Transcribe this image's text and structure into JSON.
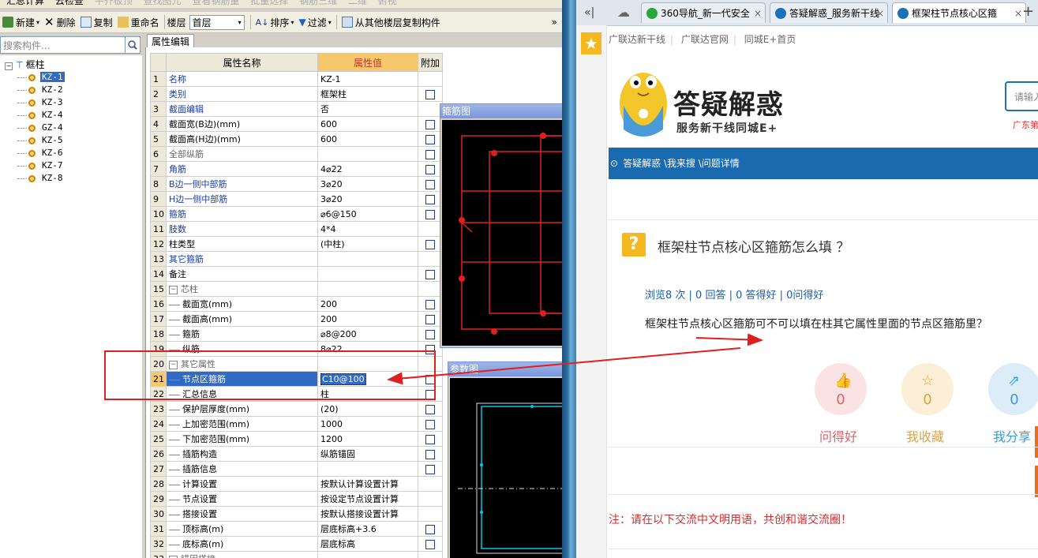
{
  "left_app": {
    "top_toolbar_partial": [
      "汇总计算",
      "云检查",
      "平齐板顶",
      "查找图元",
      "查看钢筋量",
      "批量选择",
      "钢筋三维",
      "二维",
      "俯视"
    ],
    "toolbar": {
      "new": "新建",
      "delete": "删除",
      "copy": "复制",
      "rename": "重命名",
      "floor_label": "楼层",
      "floor_value": "首层",
      "sort": "排序",
      "filter": "过滤",
      "copy_from_floor": "从其他楼层复制构件",
      "more": "»"
    },
    "search_placeholder": "搜索构件...",
    "tree": {
      "root": "框柱",
      "items": [
        "KZ-1",
        "KZ-2",
        "KZ-3",
        "KZ-4",
        "GZ-4",
        "KZ-5",
        "KZ-6",
        "KZ-7",
        "KZ-8"
      ],
      "selected": "KZ-1"
    },
    "prop_tab": "属性编辑",
    "prop_headers": {
      "num": "",
      "name": "属性名称",
      "value": "属性值",
      "extra": "附加"
    },
    "rows": [
      {
        "n": "1",
        "name": "名称",
        "value": "KZ-1",
        "cb": false,
        "color": "blue",
        "indent": 0
      },
      {
        "n": "2",
        "name": "类别",
        "value": "框架柱",
        "cb": true,
        "color": "blue",
        "indent": 0
      },
      {
        "n": "3",
        "name": "截面编辑",
        "value": "否",
        "cb": false,
        "color": "blue",
        "indent": 0
      },
      {
        "n": "4",
        "name": "截面宽(B边)(mm)",
        "value": "600",
        "cb": true,
        "color": "black",
        "indent": 0
      },
      {
        "n": "5",
        "name": "截面高(H边)(mm)",
        "value": "600",
        "cb": true,
        "color": "black",
        "indent": 0
      },
      {
        "n": "6",
        "name": "全部纵筋",
        "value": "",
        "cb": true,
        "color": "gray",
        "indent": 0
      },
      {
        "n": "7",
        "name": "角筋",
        "value": "4⌀22",
        "cb": true,
        "color": "blue",
        "indent": 0
      },
      {
        "n": "8",
        "name": "B边一侧中部筋",
        "value": "3⌀20",
        "cb": true,
        "color": "blue",
        "indent": 0
      },
      {
        "n": "9",
        "name": "H边一侧中部筋",
        "value": "3⌀20",
        "cb": true,
        "color": "blue",
        "indent": 0
      },
      {
        "n": "10",
        "name": "箍筋",
        "value": "⌀6@150",
        "cb": true,
        "color": "blue",
        "indent": 0
      },
      {
        "n": "11",
        "name": "肢数",
        "value": "4*4",
        "cb": false,
        "color": "blue",
        "indent": 0
      },
      {
        "n": "12",
        "name": "柱类型",
        "value": "(中柱)",
        "cb": true,
        "color": "black",
        "indent": 0
      },
      {
        "n": "13",
        "name": "其它箍筋",
        "value": "",
        "cb": false,
        "color": "blue",
        "indent": 0
      },
      {
        "n": "14",
        "name": "备注",
        "value": "",
        "cb": true,
        "color": "black",
        "indent": 0
      },
      {
        "n": "15",
        "name": "芯柱",
        "value": "",
        "cb": false,
        "color": "gray",
        "indent": 0,
        "group": true
      },
      {
        "n": "16",
        "name": "截面宽(mm)",
        "value": "200",
        "cb": true,
        "color": "black",
        "indent": 1
      },
      {
        "n": "17",
        "name": "截面高(mm)",
        "value": "200",
        "cb": true,
        "color": "black",
        "indent": 1
      },
      {
        "n": "18",
        "name": "箍筋",
        "value": "⌀8@200",
        "cb": true,
        "color": "black",
        "indent": 1
      },
      {
        "n": "19",
        "name": "纵筋",
        "value": "8⌀22",
        "cb": true,
        "color": "black",
        "indent": 1
      },
      {
        "n": "20",
        "name": "其它属性",
        "value": "",
        "cb": false,
        "color": "gray",
        "indent": 0,
        "group": true
      },
      {
        "n": "21",
        "name": "节点区箍筋",
        "value": "C10@100",
        "cb": true,
        "color": "black",
        "indent": 1,
        "selected": true
      },
      {
        "n": "22",
        "name": "汇总信息",
        "value": "柱",
        "cb": true,
        "color": "black",
        "indent": 1
      },
      {
        "n": "23",
        "name": "保护层厚度(mm)",
        "value": "(20)",
        "cb": true,
        "color": "black",
        "indent": 1
      },
      {
        "n": "24",
        "name": "上加密范围(mm)",
        "value": "1000",
        "cb": true,
        "color": "black",
        "indent": 1
      },
      {
        "n": "25",
        "name": "下加密范围(mm)",
        "value": "1200",
        "cb": true,
        "color": "black",
        "indent": 1
      },
      {
        "n": "26",
        "name": "插筋构造",
        "value": "纵筋锚固",
        "cb": true,
        "color": "black",
        "indent": 1
      },
      {
        "n": "27",
        "name": "插筋信息",
        "value": "",
        "cb": true,
        "color": "black",
        "indent": 1
      },
      {
        "n": "28",
        "name": "计算设置",
        "value": "按默认计算设置计算",
        "cb": false,
        "color": "black",
        "indent": 1
      },
      {
        "n": "29",
        "name": "节点设置",
        "value": "按设定节点设置计算",
        "cb": false,
        "color": "black",
        "indent": 1
      },
      {
        "n": "30",
        "name": "搭接设置",
        "value": "按默认搭接设置计算",
        "cb": false,
        "color": "black",
        "indent": 1
      },
      {
        "n": "31",
        "name": "顶标高(m)",
        "value": "层底标高+3.6",
        "cb": true,
        "color": "black",
        "indent": 1
      },
      {
        "n": "32",
        "name": "底标高(m)",
        "value": "层底标高",
        "cb": true,
        "color": "black",
        "indent": 1
      },
      {
        "n": "33",
        "name": "锚固搭接",
        "value": "",
        "cb": false,
        "color": "gray",
        "indent": 0,
        "group": true
      }
    ],
    "drawing1_title": "箍筋图",
    "drawing2_title": "参数图"
  },
  "browser": {
    "tabs": [
      {
        "label": "360导航_新一代安全",
        "icon_color": "#2aa63a"
      },
      {
        "label": "答疑解惑_服务新干线",
        "icon_color": "#1a73b8"
      },
      {
        "label": "框架柱节点核心区箍",
        "icon_color": "#1a73b8",
        "active": true
      }
    ],
    "back": "«|",
    "new_tab": "+",
    "top_links": [
      "广联达新干线",
      "广联达官网",
      "同城E+首页"
    ],
    "logo_title": "答疑解惑",
    "logo_subtitle": "服务新干线同城E+",
    "search_placeholder": "请输入",
    "region": "广东第",
    "breadcrumb": "答疑解惑 \\我来搜 \\问题详情",
    "question_title": "框架柱节点核心区箍筋怎么填 ？",
    "stats": "浏览8 次 | 0 回答 | 0 答得好 | 0问得好",
    "question_body": "框架柱节点核心区箍筋可不可以填在柱其它属性里面的节点区箍筋里？",
    "actions": [
      {
        "label": "问得好",
        "count": "0",
        "color": "#e0606a",
        "bg": "#fbe3e5"
      },
      {
        "label": "我收藏",
        "count": "0",
        "color": "#d8a441",
        "bg": "#fbefd7"
      },
      {
        "label": "我分享",
        "count": "0",
        "color": "#3c9ad4",
        "bg": "#dcedf8"
      }
    ],
    "note": "注：请在以下交流中文明用语，共创和谐交流圈！"
  }
}
